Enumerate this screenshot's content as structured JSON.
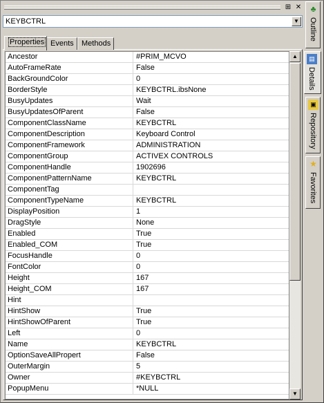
{
  "window": {
    "pin_glyph": "⊞",
    "close_glyph": "✕"
  },
  "combo": {
    "value": "KEYBCTRL"
  },
  "tabs": [
    {
      "label": "Properties",
      "active": true
    },
    {
      "label": "Events",
      "active": false
    },
    {
      "label": "Methods",
      "active": false
    }
  ],
  "side_tabs": [
    {
      "label": "Outline",
      "icon": "outline-icon"
    },
    {
      "label": "Details",
      "icon": "details-icon"
    },
    {
      "label": "Repository",
      "icon": "repository-icon"
    },
    {
      "label": "Favorites",
      "icon": "favorites-icon"
    }
  ],
  "properties": [
    {
      "name": "Ancestor",
      "value": "#PRIM_MCVO"
    },
    {
      "name": "AutoFrameRate",
      "value": "False"
    },
    {
      "name": "BackGroundColor",
      "value": "0"
    },
    {
      "name": "BorderStyle",
      "value": "KEYBCTRL.ibsNone"
    },
    {
      "name": "BusyUpdates",
      "value": "Wait"
    },
    {
      "name": "BusyUpdatesOfParent",
      "value": "False"
    },
    {
      "name": "ComponentClassName",
      "value": "KEYBCTRL"
    },
    {
      "name": "ComponentDescription",
      "value": "Keyboard Control"
    },
    {
      "name": "ComponentFramework",
      "value": "ADMINISTRATION"
    },
    {
      "name": "ComponentGroup",
      "value": "ACTIVEX CONTROLS"
    },
    {
      "name": "ComponentHandle",
      "value": "1902696"
    },
    {
      "name": "ComponentPatternName",
      "value": "KEYBCTRL"
    },
    {
      "name": "ComponentTag",
      "value": ""
    },
    {
      "name": "ComponentTypeName",
      "value": "KEYBCTRL"
    },
    {
      "name": "DisplayPosition",
      "value": "1"
    },
    {
      "name": "DragStyle",
      "value": "None"
    },
    {
      "name": "Enabled",
      "value": "True"
    },
    {
      "name": "Enabled_COM",
      "value": "True"
    },
    {
      "name": "FocusHandle",
      "value": "0"
    },
    {
      "name": "FontColor",
      "value": "0"
    },
    {
      "name": "Height",
      "value": "167"
    },
    {
      "name": "Height_COM",
      "value": "167"
    },
    {
      "name": "Hint",
      "value": ""
    },
    {
      "name": "HintShow",
      "value": "True"
    },
    {
      "name": "HintShowOfParent",
      "value": "True"
    },
    {
      "name": "Left",
      "value": "0"
    },
    {
      "name": "Name",
      "value": "KEYBCTRL"
    },
    {
      "name": "OptionSaveAllPropert",
      "value": "False"
    },
    {
      "name": "OuterMargin",
      "value": "5"
    },
    {
      "name": "Owner",
      "value": "#KEYBCTRL"
    },
    {
      "name": "PopupMenu",
      "value": "*NULL"
    }
  ]
}
